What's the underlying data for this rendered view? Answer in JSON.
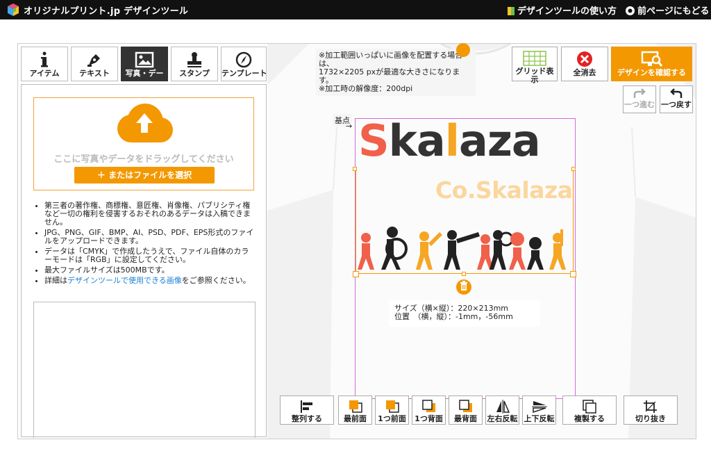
{
  "header": {
    "brand": "オリジナルプリント.jp デザインツール",
    "help_link": "デザインツールの使い方",
    "back_link": "前ページにもどる"
  },
  "tabs": [
    {
      "label": "アイテム",
      "icon": "info-icon"
    },
    {
      "label": "テキスト",
      "icon": "pen-icon"
    },
    {
      "label": "写真・デー",
      "icon": "image-icon",
      "active": true
    },
    {
      "label": "スタンプ",
      "icon": "stamp-icon"
    },
    {
      "label": "テンプレート",
      "icon": "compass-icon"
    }
  ],
  "upload": {
    "drop_text": "ここに写真やデータをドラッグしてください",
    "select_button": "＋ またはファイルを選択"
  },
  "notes": {
    "item1": "第三者の著作権、商標権、意匠権、肖像権、パブリシティ権など一切の権利を侵害するおそれのあるデータは入稿できません。",
    "item2": "JPG、PNG、GIF、BMP、AI、PSD、PDF、EPS形式のファイルをアップロードできます。",
    "item3": "データは「CMYK」で作成したうえで、ファイル自体のカラーモードは「RGB」に設定してください。",
    "item4": "最大ファイルサイズは500MBです。",
    "item5_pre": "詳細は",
    "item5_link": "デザインツールで使用できる画像",
    "item5_post": "をご参照ください。"
  },
  "canvas_note": {
    "line1": "※加工範囲いっぱいに画像を配置する場合は、",
    "line2": "1732×2205 pxが最適な大きさになります。",
    "line3": "※加工時の解像度：200dpi"
  },
  "top_tools": {
    "grid": "グリッド表示",
    "clear": "全消去",
    "confirm": "デザインを確認する"
  },
  "history": {
    "redo": "一つ進む",
    "undo": "一つ戻す"
  },
  "origin_label": "基点",
  "design": {
    "logo_s": "S",
    "logo_k": "ka",
    "logo_l": "l",
    "logo_rest": "aza",
    "logo_sub": "Co.Skalaza"
  },
  "size_info": {
    "size_line": "サイズ（横×縦）：220×213mm",
    "pos_line": "位置　（横，縦）：-1mm，-56mm"
  },
  "bottom_tools": {
    "align": "整列する",
    "front": "最前面",
    "forward": "1つ前面",
    "backward": "1つ背面",
    "back": "最背面",
    "flip_h": "左右反転",
    "flip_v": "上下反転",
    "duplicate": "複製する",
    "crop": "切り抜き"
  },
  "colors": {
    "accent": "#f39800",
    "print_area": "#d36bd6"
  }
}
